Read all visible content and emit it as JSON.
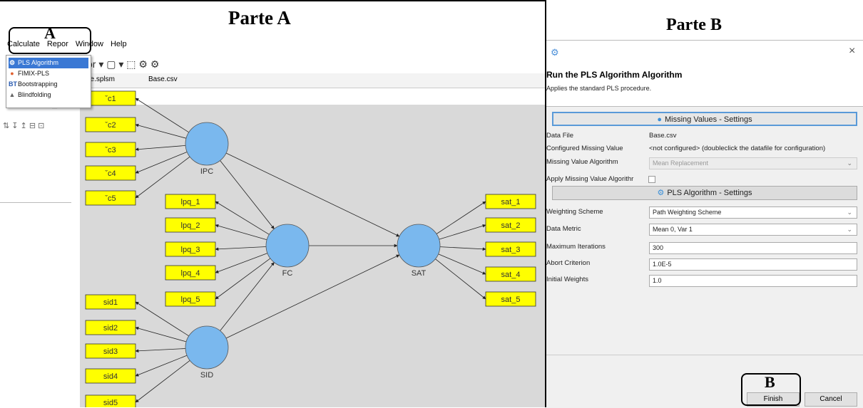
{
  "partA": {
    "title": "Parte A",
    "menu": [
      "Calculate",
      "Repor",
      "Window",
      "Help"
    ],
    "toolbar_text": "or ▾ ▢ ▾ ⬚ ⚙ ⚙",
    "tabs": [
      "ase.splsm",
      "Base.csv"
    ],
    "callout_letter": "A",
    "dropdown": [
      {
        "label": "PLS Algorithm",
        "icon": "gear-icon",
        "selected": true
      },
      {
        "label": "FIMIX-PLS",
        "icon": "palette-icon",
        "selected": false
      },
      {
        "label": "Bootstrapping",
        "icon": "bt-icon",
        "selected": false
      },
      {
        "label": "Blindfolding",
        "icon": "blindfold-icon",
        "selected": false
      }
    ],
    "side_controls": [
      "⊡ ☐",
      "⇅ ↧ ↥  ⊟ ⊡"
    ],
    "constructs": [
      {
        "id": "IPC",
        "label": "IPC"
      },
      {
        "id": "FC",
        "label": "FC"
      },
      {
        "id": "SAT",
        "label": "SAT"
      },
      {
        "id": "SID",
        "label": "SID"
      }
    ],
    "indicators": {
      "IPC": [
        "ˇc1",
        "ˇc2",
        "ˇc3",
        "ˇc4",
        "ˇc5"
      ],
      "FC": [
        "lpq_1",
        "lpq_2",
        "lpq_3",
        "lpq_4",
        "lpq_5"
      ],
      "SAT": [
        "sat_1",
        "sat_2",
        "sat_3",
        "sat_4",
        "sat_5"
      ],
      "SID": [
        "sid1",
        "sid2",
        "sid3",
        "sid4",
        "sid5"
      ]
    },
    "colors": {
      "construct": "#7ab8ee",
      "indicator": "#ffff00",
      "canvas": "#d9d9d9",
      "selection": "#3a78d4"
    }
  },
  "partB": {
    "title": "Parte B",
    "dialog_title": "Run the PLS Algorithm Algorithm",
    "dialog_subtitle": "Applies the standard PLS procedure.",
    "close_icon": "×",
    "missing_section": "Missing Values - Settings",
    "pls_section": "PLS Algorithm - Settings",
    "rows": {
      "data_file": {
        "label": "Data File",
        "value": "Base.csv"
      },
      "configured_missing": {
        "label": "Configured Missing Value",
        "value": "<not configured> (doubleclick the datafile for configuration)"
      },
      "missing_algorithm": {
        "label": "Missing Value Algorithm",
        "value": "Mean Replacement"
      },
      "apply_missing": {
        "label": "Apply Missing Value Algorithr"
      },
      "weighting": {
        "label": "Weighting Scheme",
        "value": "Path Weighting Scheme"
      },
      "metric": {
        "label": "Data Metric",
        "value": "Mean 0, Var 1"
      },
      "max_iter": {
        "label": "Maximum Iterations",
        "value": "300"
      },
      "abort": {
        "label": "Abort Criterion",
        "value": "1.0E-5"
      },
      "initial": {
        "label": "Initial Weights",
        "value": "1.0"
      }
    },
    "buttons": {
      "finish": "Finish",
      "cancel": "Cancel"
    },
    "callout_letter": "B"
  }
}
